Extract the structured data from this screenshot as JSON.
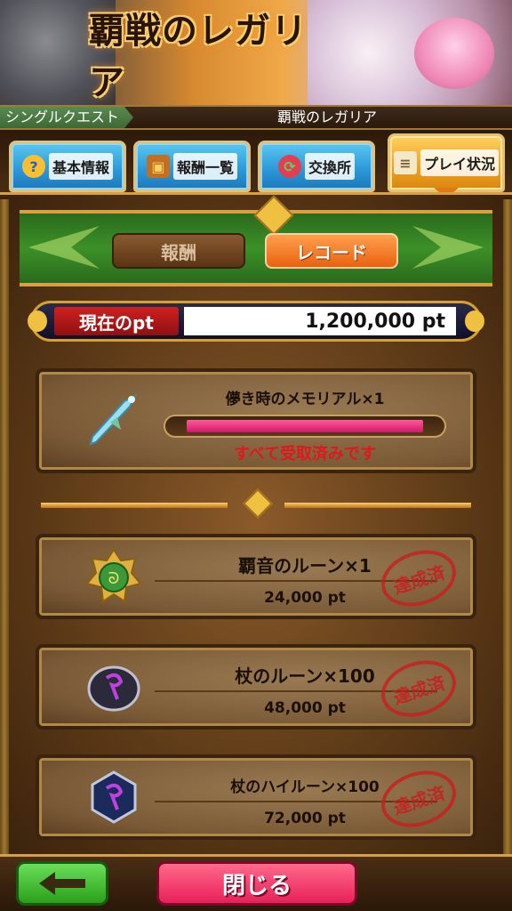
{
  "banner": {
    "logo_text": "覇戦のレガリア"
  },
  "quest_bar": {
    "label": "シングルクエスト",
    "title": "覇戦のレガリア"
  },
  "tabs": [
    {
      "label": "基本情報",
      "icon": "question-icon"
    },
    {
      "label": "報酬一覧",
      "icon": "treasure-chest-icon"
    },
    {
      "label": "交換所",
      "icon": "exchange-icon"
    },
    {
      "label": "プレイ状況",
      "icon": "scroll-icon",
      "active": true
    }
  ],
  "subtabs": {
    "rewards": "報酬",
    "record": "レコード"
  },
  "points": {
    "label": "現在のpt",
    "value": "1,200,000 pt"
  },
  "top_reward": {
    "name": "儚き時のメモリアル×1",
    "icon": "sword-icon",
    "progress": 1.0,
    "status": "すべて受取済みです"
  },
  "rewards": [
    {
      "name": "覇音のルーン×1",
      "points": "24,000 pt",
      "icon": "rune-badge-icon",
      "stamp": "達成済"
    },
    {
      "name": "杖のルーン×100",
      "points": "48,000 pt",
      "icon": "dark-rune-icon",
      "stamp": "達成済"
    },
    {
      "name": "杖のハイルーン×100",
      "points": "72,000 pt",
      "icon": "hexagon-rune-icon",
      "stamp": "達成済"
    }
  ],
  "buttons": {
    "close": "閉じる",
    "back_icon": "back-arrow-icon"
  },
  "colors": {
    "accent_orange": "#e8620e",
    "status_red": "#e0181e",
    "tab_blue": "#2a96d8",
    "close_pink": "#e8205a",
    "back_green": "#2aa01a"
  }
}
